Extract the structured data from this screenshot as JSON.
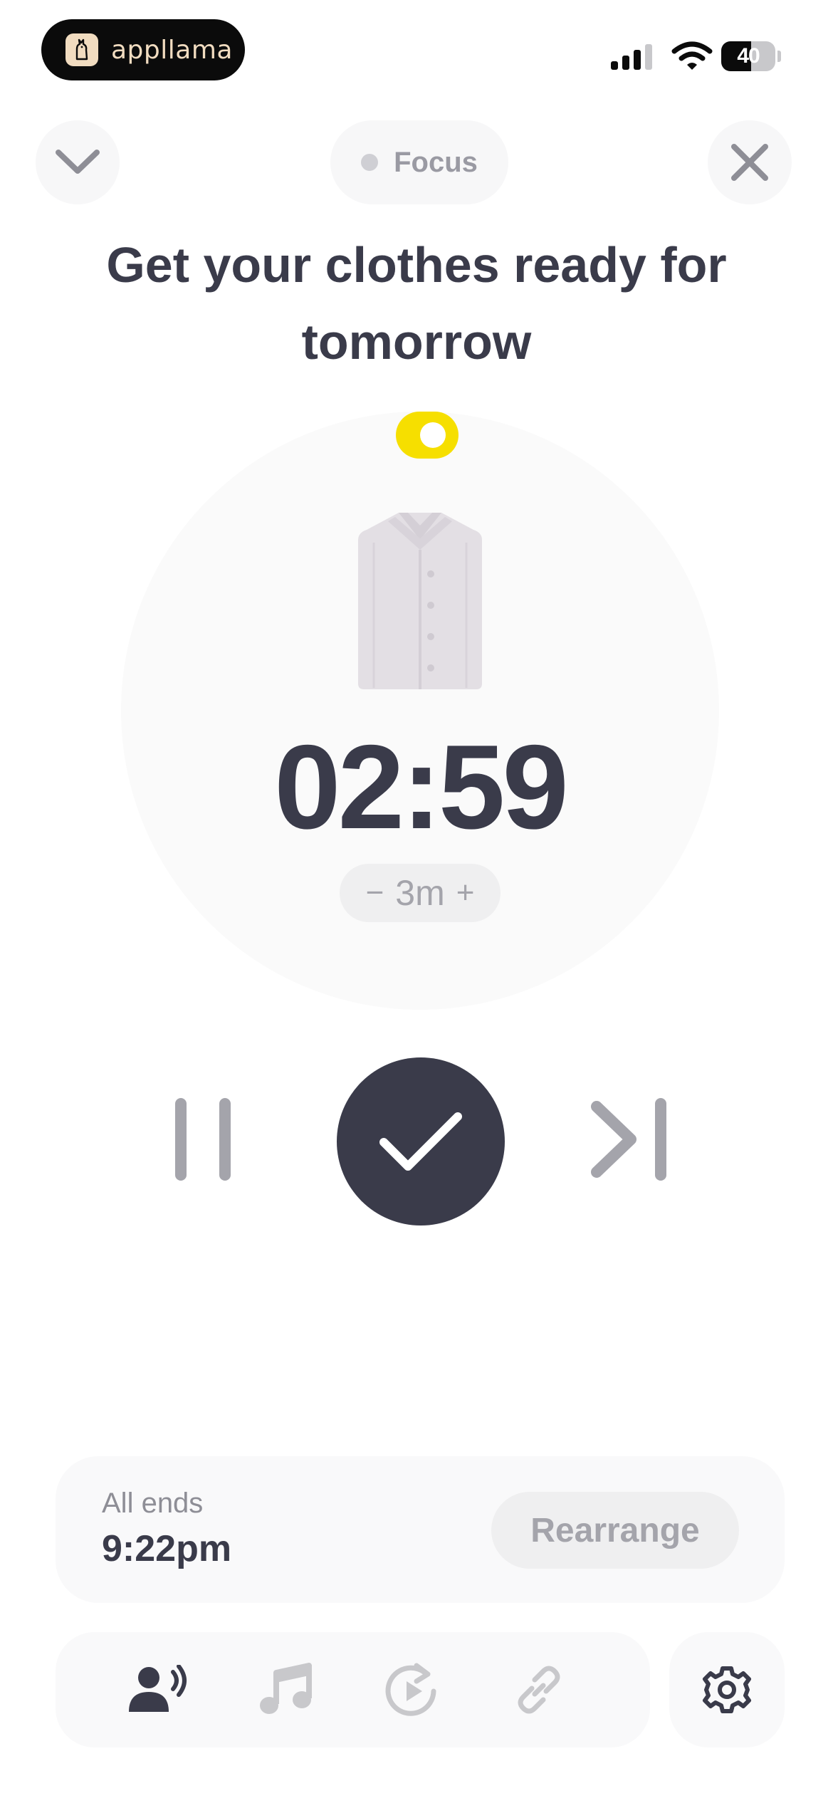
{
  "status_bar": {
    "brand_name": "appllama",
    "battery_level": "40",
    "battery_fraction": 0.55
  },
  "header": {
    "mode_label": "Focus"
  },
  "task": {
    "title": "Get your clothes ready for tomorrow",
    "time_remaining": "02:59",
    "duration_minus": "−",
    "duration_label": "3m",
    "duration_plus": "+",
    "illustration": "shirt-icon"
  },
  "schedule": {
    "ends_label": "All ends",
    "ends_time": "9:22pm",
    "rearrange_label": "Rearrange"
  },
  "icons": {
    "collapse": "chevron-down-icon",
    "close": "close-icon",
    "pause": "pause-icon",
    "complete": "check-icon",
    "skip": "skip-next-icon",
    "voice": "voice-icon",
    "music": "music-icon",
    "repeat": "repeat-icon",
    "link": "link-icon",
    "settings": "gear-icon"
  },
  "colors": {
    "accent_yellow": "#f6df00",
    "primary_dark": "#3a3b4a",
    "muted_gray": "#a4a4ab"
  }
}
